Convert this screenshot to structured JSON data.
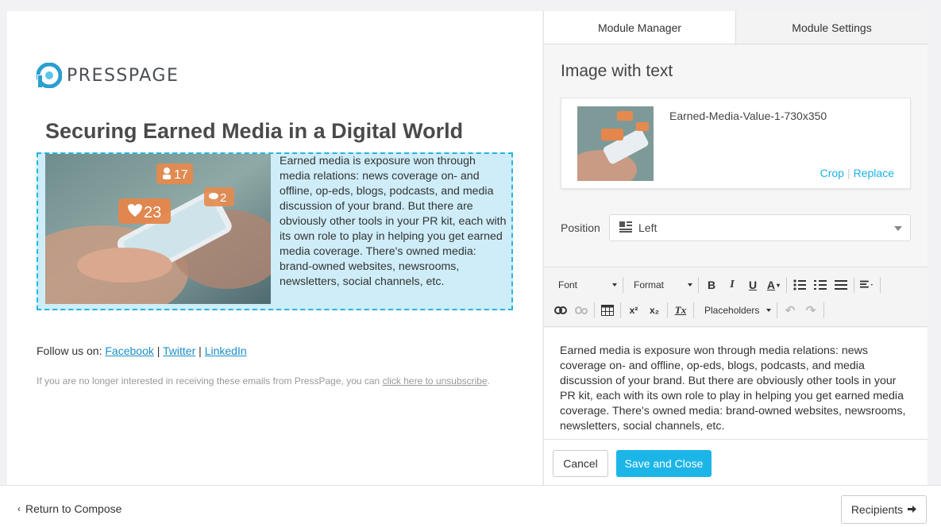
{
  "email": {
    "brand": "PRESSPAGE",
    "title": "Securing Earned Media in a Digital World",
    "body_text": "Earned media is exposure won through media relations: news coverage on- and offline, op-eds, blogs, podcasts, and media discussion of your brand. But there are obviously other tools in your PR kit, each with its own role to play in helping you get earned media coverage. There's owned media: brand-owned websites, newsrooms, newsletters, social channels, etc.",
    "image_badges": {
      "people": "17",
      "hearts": "23",
      "comments": "2"
    },
    "follow_prefix": "Follow us on:",
    "social_links": [
      "Facebook",
      "Twitter",
      "LinkedIn"
    ],
    "social_sep": "|",
    "unsubscribe_prefix": "If you are no longer interested in receiving these emails from PressPage, you can",
    "unsubscribe_link": "click here to unsubscribe",
    "unsubscribe_suffix": "."
  },
  "panel": {
    "tabs": [
      {
        "label": "Module Manager"
      },
      {
        "label": "Module Settings"
      }
    ],
    "module_name": "Image with text",
    "image": {
      "file_name": "Earned-Media-Value-1-730x350",
      "crop_label": "Crop",
      "separator": "|",
      "replace_label": "Replace"
    },
    "position": {
      "label": "Position",
      "value": "Left"
    },
    "toolbar": {
      "font_label": "Font",
      "format_label": "Format",
      "placeholders_label": "Placeholders",
      "bold_glyph": "B",
      "italic_glyph": "I",
      "underline_glyph": "U",
      "text_color_glyph": "A",
      "superscript_glyph": "x²",
      "subscript_glyph": "x₂",
      "clear_format_glyph": "Tx"
    },
    "editor_text": "Earned media is exposure won through media relations: news coverage on- and offline, op-eds, blogs, podcasts, and media discussion of your brand. But there are obviously other tools in your PR kit, each with its own role to play in helping you get earned media coverage. There's owned media: brand-owned websites, newsrooms, newsletters, social channels, etc.",
    "cancel_label": "Cancel",
    "save_label": "Save and Close"
  },
  "bottom": {
    "return_label": "Return to Compose",
    "recipients_label": "Recipients"
  },
  "colors": {
    "accent": "#1cb5e8",
    "module_bg": "#ceedf8",
    "module_border": "#23b6e0",
    "link": "#1a8fc9"
  }
}
